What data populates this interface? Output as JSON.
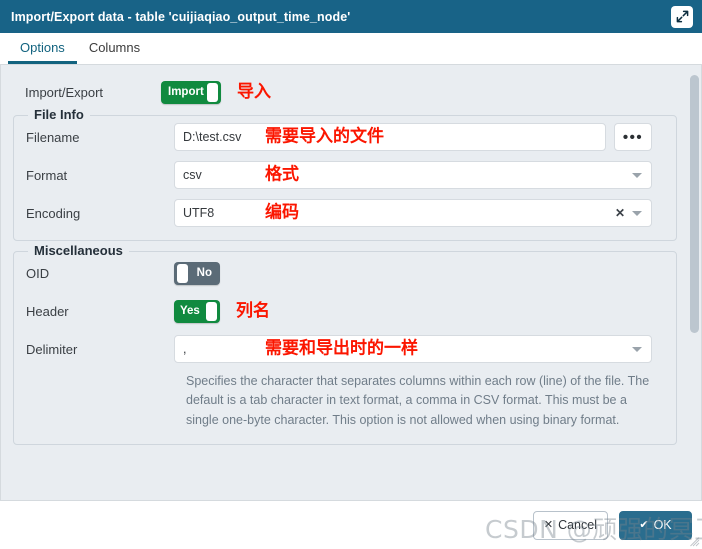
{
  "window": {
    "title": "Import/Export data - table 'cuijiaqiao_output_time_node'",
    "expand_icon": "expand-diagonal-icon"
  },
  "tabs": [
    {
      "label": "Options",
      "active": true
    },
    {
      "label": "Columns",
      "active": false
    }
  ],
  "form": {
    "import_export": {
      "label": "Import/Export",
      "toggle_value": "Import",
      "toggle_state": "on",
      "annotation": "导入"
    },
    "file_info": {
      "title": "File Info",
      "filename": {
        "label": "Filename",
        "value": "D:\\test.csv",
        "annotation": "需要导入的文件",
        "browse_label": "•••"
      },
      "format": {
        "label": "Format",
        "value": "csv",
        "annotation": "格式"
      },
      "encoding": {
        "label": "Encoding",
        "value": "UTF8",
        "annotation": "编码",
        "clear_label": "✕"
      }
    },
    "miscellaneous": {
      "title": "Miscellaneous",
      "oid": {
        "label": "OID",
        "toggle_value": "No",
        "toggle_state": "off"
      },
      "header": {
        "label": "Header",
        "toggle_value": "Yes",
        "toggle_state": "on",
        "annotation": "列名"
      },
      "delimiter": {
        "label": "Delimiter",
        "value": ",",
        "annotation": "需要和导出时的一样",
        "help": "Specifies the character that separates columns within each row (line) of the file. The default is a tab character in text format, a comma in CSV format. This must be a single one-byte character. This option is not allowed when using binary format."
      }
    }
  },
  "footer": {
    "cancel_label": "Cancel",
    "cancel_icon": "✕",
    "ok_label": "OK",
    "ok_icon": "✔"
  },
  "watermark": "CSDN @顽强的冥卫星",
  "colors": {
    "titlebar": "#186387",
    "accent": "#12637f",
    "toggle_on": "#108a3f",
    "toggle_off": "#5b6b77",
    "annotation": "#fb1600",
    "primary_button": "#2a6d8e",
    "body_bg": "#e9edf1"
  }
}
